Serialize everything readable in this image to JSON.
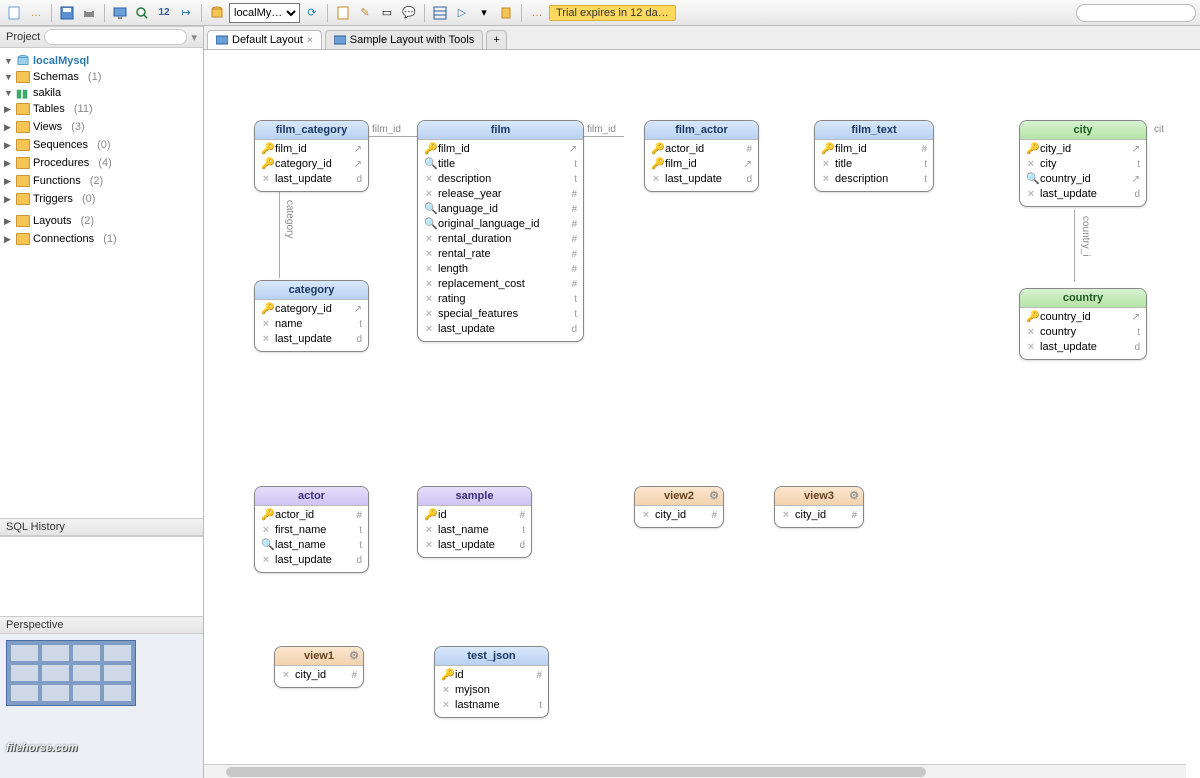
{
  "toolbar": {
    "connection_selector": "localMy…",
    "trial_text": "Trial expires in 12 da…",
    "search_placeholder": ""
  },
  "sidebar": {
    "project_label": "Project",
    "root": {
      "name": "localMysql",
      "caret": "▼"
    },
    "schemas": {
      "label": "Schemas",
      "count": "(1)",
      "caret": "▼"
    },
    "sakila": {
      "label": "sakila",
      "caret": "▼"
    },
    "items": [
      {
        "label": "Tables",
        "count": "(11)"
      },
      {
        "label": "Views",
        "count": "(3)"
      },
      {
        "label": "Sequences",
        "count": "(0)"
      },
      {
        "label": "Procedures",
        "count": "(4)"
      },
      {
        "label": "Functions",
        "count": "(2)"
      },
      {
        "label": "Triggers",
        "count": "(0)"
      }
    ],
    "layouts": {
      "label": "Layouts",
      "count": "(2)"
    },
    "connections": {
      "label": "Connections",
      "count": "(1)"
    },
    "sql_history_label": "SQL History",
    "perspective_label": "Perspective"
  },
  "tabs": [
    {
      "label": "Default Layout",
      "active": true
    },
    {
      "label": "Sample Layout with Tools",
      "active": false
    }
  ],
  "relations": [
    {
      "label": "film_id",
      "writing": "left"
    },
    {
      "label": "film_id",
      "writing": "right"
    },
    {
      "label": "cit"
    },
    {
      "label": "category"
    },
    {
      "label": "country_i"
    }
  ],
  "entities": {
    "film_category": {
      "title": "film_category",
      "style": "blue",
      "cols": [
        {
          "ic": "pk",
          "name": "film_id",
          "t": "",
          "edge": "fk"
        },
        {
          "ic": "pk",
          "name": "category_id",
          "t": "",
          "edge": "fk"
        },
        {
          "ic": "pl",
          "name": "last_update",
          "t": "d"
        }
      ]
    },
    "film": {
      "title": "film",
      "style": "blue",
      "cols": [
        {
          "ic": "pk",
          "name": "film_id",
          "t": "",
          "edge": "pk"
        },
        {
          "ic": "idx",
          "name": "title",
          "t": "t"
        },
        {
          "ic": "pl",
          "name": "description",
          "t": "t"
        },
        {
          "ic": "pl",
          "name": "release_year",
          "t": "#"
        },
        {
          "ic": "idx",
          "name": "language_id",
          "t": "#"
        },
        {
          "ic": "idx",
          "name": "original_language_id",
          "t": "#"
        },
        {
          "ic": "pl",
          "name": "rental_duration",
          "t": "#"
        },
        {
          "ic": "pl",
          "name": "rental_rate",
          "t": "#"
        },
        {
          "ic": "pl",
          "name": "length",
          "t": "#"
        },
        {
          "ic": "pl",
          "name": "replacement_cost",
          "t": "#"
        },
        {
          "ic": "pl",
          "name": "rating",
          "t": "t"
        },
        {
          "ic": "pl",
          "name": "special_features",
          "t": "t"
        },
        {
          "ic": "pl",
          "name": "last_update",
          "t": "d"
        }
      ]
    },
    "film_actor": {
      "title": "film_actor",
      "style": "blue",
      "cols": [
        {
          "ic": "pk",
          "name": "actor_id",
          "t": "#"
        },
        {
          "ic": "pk",
          "name": "film_id",
          "t": "",
          "edge": "fk"
        },
        {
          "ic": "pl",
          "name": "last_update",
          "t": "d"
        }
      ]
    },
    "film_text": {
      "title": "film_text",
      "style": "blue",
      "cols": [
        {
          "ic": "pk",
          "name": "film_id",
          "t": "#"
        },
        {
          "ic": "pl",
          "name": "title",
          "t": "t"
        },
        {
          "ic": "pl",
          "name": "description",
          "t": "t"
        }
      ]
    },
    "city": {
      "title": "city",
      "style": "green",
      "cols": [
        {
          "ic": "pk",
          "name": "city_id",
          "t": "",
          "edge": "pk"
        },
        {
          "ic": "pl",
          "name": "city",
          "t": "t"
        },
        {
          "ic": "idx",
          "name": "country_id",
          "t": "",
          "edge": "fk"
        },
        {
          "ic": "pl",
          "name": "last_update",
          "t": "d"
        }
      ]
    },
    "category": {
      "title": "category",
      "style": "blue",
      "cols": [
        {
          "ic": "pk",
          "name": "category_id",
          "t": "",
          "edge": "pk"
        },
        {
          "ic": "pl",
          "name": "name",
          "t": "t"
        },
        {
          "ic": "pl",
          "name": "last_update",
          "t": "d"
        }
      ]
    },
    "country": {
      "title": "country",
      "style": "green",
      "cols": [
        {
          "ic": "pk",
          "name": "country_id",
          "t": "",
          "edge": "pk"
        },
        {
          "ic": "pl",
          "name": "country",
          "t": "t"
        },
        {
          "ic": "pl",
          "name": "last_update",
          "t": "d"
        }
      ]
    },
    "actor": {
      "title": "actor",
      "style": "purple",
      "cols": [
        {
          "ic": "pk",
          "name": "actor_id",
          "t": "#"
        },
        {
          "ic": "pl",
          "name": "first_name",
          "t": "t"
        },
        {
          "ic": "idx",
          "name": "last_name",
          "t": "t"
        },
        {
          "ic": "pl",
          "name": "last_update",
          "t": "d"
        }
      ]
    },
    "sample": {
      "title": "sample",
      "style": "purple",
      "cols": [
        {
          "ic": "pk",
          "name": "id",
          "t": "#"
        },
        {
          "ic": "pl",
          "name": "last_name",
          "t": "t"
        },
        {
          "ic": "pl",
          "name": "last_update",
          "t": "d"
        }
      ]
    },
    "view2": {
      "title": "view2",
      "style": "orange",
      "gear": true,
      "cols": [
        {
          "ic": "pl",
          "name": "city_id",
          "t": "#"
        }
      ]
    },
    "view3": {
      "title": "view3",
      "style": "orange",
      "gear": true,
      "cols": [
        {
          "ic": "pl",
          "name": "city_id",
          "t": "#"
        }
      ]
    },
    "view1": {
      "title": "view1",
      "style": "orange",
      "gear": true,
      "cols": [
        {
          "ic": "pl",
          "name": "city_id",
          "t": "#"
        }
      ]
    },
    "test_json": {
      "title": "test_json",
      "style": "blue",
      "cols": [
        {
          "ic": "pk",
          "name": "id",
          "t": "#"
        },
        {
          "ic": "pl",
          "name": "myjson",
          "t": ""
        },
        {
          "ic": "pl",
          "name": "lastname",
          "t": "t"
        }
      ]
    }
  },
  "watermark": "filehorse.com"
}
